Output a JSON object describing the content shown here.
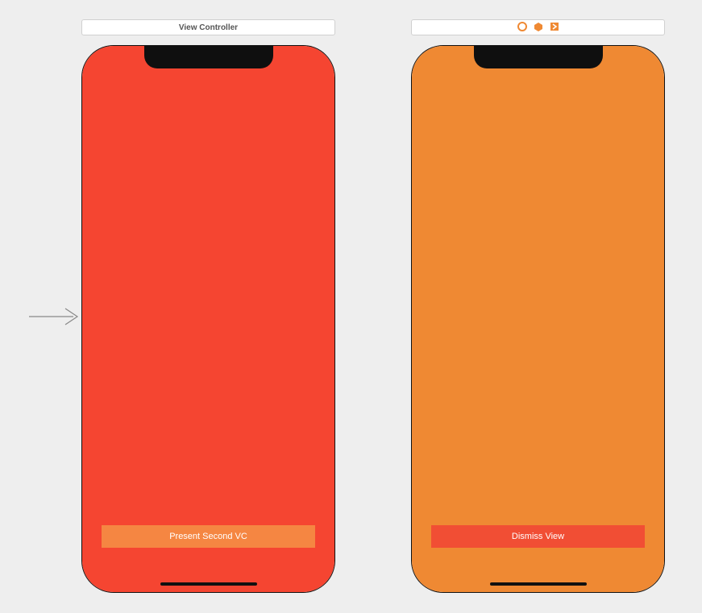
{
  "canvas": {
    "background": "#eeeeee"
  },
  "scenes": {
    "left": {
      "title": "View Controller",
      "screen_color": "#f54531",
      "button": {
        "label": "Present Second VC",
        "bg": "#f58642"
      }
    },
    "right": {
      "title_icons": [
        "vc-identity-icon",
        "first-responder-icon",
        "exit-icon"
      ],
      "screen_color": "#ef8933",
      "button": {
        "label": "Dismiss View",
        "bg": "#f14e34"
      }
    }
  },
  "entry_point": {
    "target": "left"
  }
}
